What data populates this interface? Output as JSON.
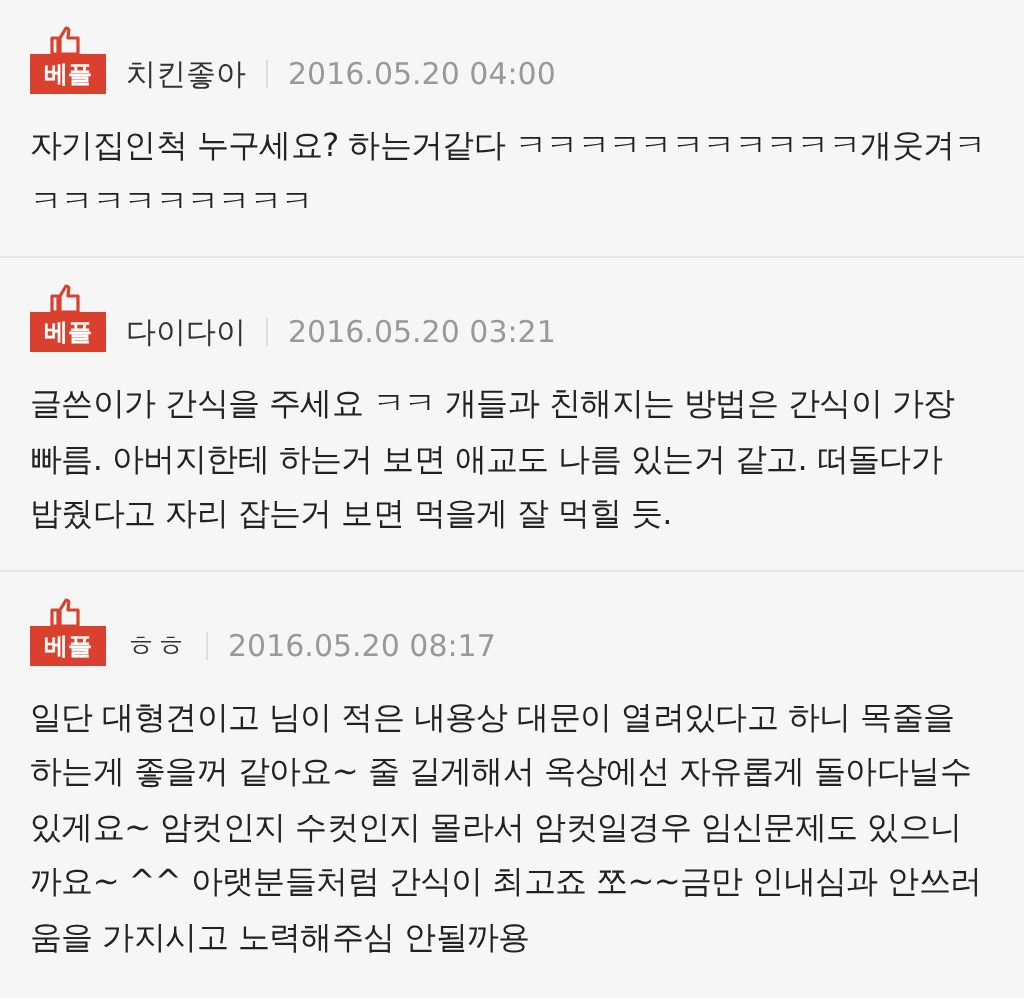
{
  "comments": [
    {
      "badge": "베플",
      "author": "치킨좋아",
      "date": "2016.05.20 04:00",
      "lines": [
        "자기집인척 누구세요? 하는거같다 ㅋㅋㅋㅋㅋㅋㅋㅋㅋㅋㅋ개웃겨ㅋ",
        "ㅋㅋㅋㅋㅋㅋㅋㅋㅋ"
      ]
    },
    {
      "badge": "베플",
      "author": "다이다이",
      "date": "2016.05.20 03:21",
      "lines": [
        "글쓴이가 간식을 주세요 ㅋㅋ 개들과 친해지는 방법은 간식이 가장",
        "빠름. 아버지한테 하는거 보면 애교도 나름 있는거 같고. 떠돌다가",
        "밥줬다고 자리 잡는거 보면 먹을게 잘 먹힐 듯."
      ]
    },
    {
      "badge": "베플",
      "author": "ㅎㅎ",
      "date": "2016.05.20 08:17",
      "lines": [
        "일단 대형견이고 님이 적은 내용상 대문이 열려있다고 하니 목줄을",
        "하는게 좋을꺼 같아요~ 줄 길게해서 옥상에선 자유롭게 돌아다닐수",
        "있게요~ 암컷인지 수컷인지 몰라서 암컷일경우 임신문제도 있으니",
        "까요~ ^^ 아랫분들처럼 간식이 최고죠 쪼~~금만 인내심과 안쓰러",
        "움을 가지시고 노력해주심 안될까용"
      ]
    }
  ]
}
